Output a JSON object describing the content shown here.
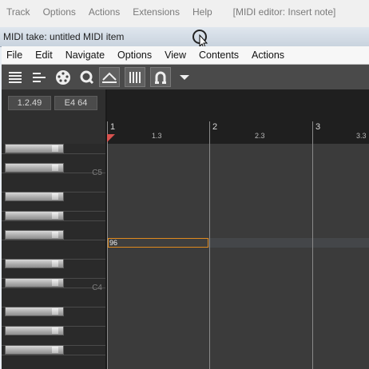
{
  "host_menu": {
    "items": [
      "Track",
      "Options",
      "Actions",
      "Extensions",
      "Help"
    ],
    "title": "[MIDI editor: Insert note]"
  },
  "window": {
    "title": "MIDI take: untitled MIDI item"
  },
  "menubar": {
    "items": [
      "File",
      "Edit",
      "Navigate",
      "Options",
      "View",
      "Contents",
      "Actions"
    ]
  },
  "toolbar": {
    "buttons": [
      {
        "icon": "menu-lines-icon",
        "active": false
      },
      {
        "icon": "align-lines-icon",
        "active": false
      },
      {
        "icon": "midi-port-icon",
        "active": false
      },
      {
        "icon": "quantize-icon",
        "active": false
      },
      {
        "icon": "triangle-arrow-icon",
        "active": true
      },
      {
        "icon": "grid-bars-icon",
        "active": true
      },
      {
        "icon": "magnet-snap-icon",
        "active": true
      },
      {
        "icon": "dropdown-arrow-icon",
        "active": false
      }
    ]
  },
  "info": {
    "position": "1.2.49",
    "note": "E4  64"
  },
  "ruler": {
    "bars": [
      "1",
      "2",
      "3"
    ],
    "subdivisions": [
      "1.3",
      "2.3",
      "3.3"
    ]
  },
  "piano": {
    "labels": [
      "C5",
      "C4"
    ]
  },
  "note": {
    "velocity": "96"
  }
}
